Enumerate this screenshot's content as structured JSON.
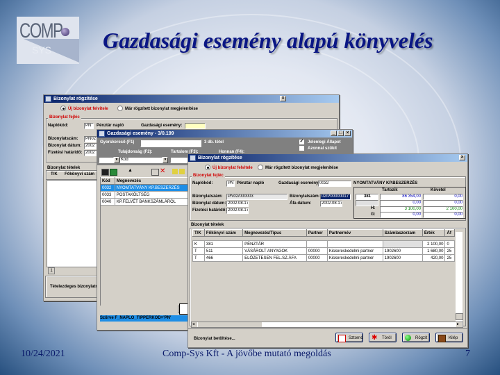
{
  "slide": {
    "title": "Gazdasági esemény alapú könyvelés",
    "logo_top": "COMP",
    "logo_bottom": "SYS",
    "footer_date": "10/24/2021",
    "footer_center": "Comp-Sys Kft - A jövőbe mutató megoldás",
    "page_number": "7"
  },
  "win1": {
    "title": "Bizonylat rögzítése",
    "radio_new": "Új bizonylat felvitele",
    "radio_edit": "Már rögzített bizonylat megjelenítése",
    "group_head": "Bizonylat fejléc",
    "naplokod_label": "Naplókód:",
    "naplokod_value": "PN",
    "naplokod_name": "Pénztár napló",
    "gazd_label": "Gazdasági esemény:",
    "bizszam_label": "Bizonylatszám:",
    "bizszam_value": "PN02",
    "bizdatum_label": "Bizonylat dátum:",
    "bizdatum_value": "2002",
    "fizhat_label": "Fizetési határidő:",
    "fizhat_value": "2002",
    "items_group": "Bizonylat tételek",
    "col_tk": "T/K",
    "col_fokonyv": "Főkönyvi szám",
    "page": "1",
    "status": "Tételezdeges bizonylatr"
  },
  "win2": {
    "title": "Gazdasági esemény - 3/0.199",
    "gyors_label": "Gyorskereső (F1)",
    "count": "3 db. tétel",
    "tulajdonsag_label": "Tulajdonság (F2):",
    "tulajdonsag_value": "Kód",
    "tartalom_label": "Tartalom (F3):",
    "honnan_label": "Honnan (F4):",
    "chk_jelenlegi": "Jelenlegi Állapot",
    "chk_azonnal": "Azonnal szűkít",
    "col_kod": "Kód",
    "col_megnevezes": "Megnevezés",
    "rows": [
      {
        "kod": "0032",
        "megnevezes": "NYOMTATVÁNY KP.BESZERZÉS"
      },
      {
        "kod": "0033",
        "megnevezes": "POSTAKÖLTSÉG"
      },
      {
        "kod": "0040",
        "megnevezes": "KP.FELVÉT BANKSZÁMLÁRÓL"
      }
    ],
    "filter": "Szűrve F_NAPLO_TIPPERKOD='PN'"
  },
  "win3": {
    "title": "Bizonylat rögzítése",
    "radio_new": "Új bizonylat felvitele",
    "radio_edit": "Már rögzített bizonylat megjelenítése",
    "group_head": "Bizonylat fejléc",
    "naplokod_label": "Naplókód:",
    "naplokod_value": "PN",
    "naplokod_name": "Pénztár napló",
    "gazd_label": "Gazdasági esemény:",
    "gazd_value": "0032",
    "bizszam_label": "Bizonylatszám:",
    "bizszam_value": "PN02/000003",
    "bizdatum_label": "Bizonylat dátum:",
    "bizdatum_value": "2002.08.17",
    "fizhat_label": "Fizetési határidő:",
    "fizhat_value": "2002.08.17",
    "bizszam2_label": "Bizonylatszám:",
    "bizszam2_value": "02/P00000017",
    "afa_label": "Áfa dátum:",
    "afa_value": "2002.08.17",
    "event_name": "NYOMTATVÁNY KP.BESZERZÉS",
    "summary": {
      "col_tartozik": "Tartozik",
      "col_kovetel": "Követel",
      "rows": [
        {
          "label": "381",
          "tartozik": "86 354,00",
          "kovetel": "0,00"
        },
        {
          "label": "",
          "tartozik": "0,00",
          "kovetel": "0,00"
        },
        {
          "label": "H:",
          "tartozik": "3 100,00",
          "kovetel": "2 100,00"
        },
        {
          "label": "G:",
          "tartozik": "0,00",
          "kovetel": "0,00"
        }
      ]
    },
    "items_group": "Bizonylat tételek",
    "columns": [
      "T/K",
      "Főkönyvi szám",
      "Megnevezés/Típus",
      "Partner",
      "Partnernév",
      "Számlaszorzam",
      "Érték",
      "Áf"
    ],
    "rows": [
      {
        "tk": "K",
        "fokonyv": "381",
        "megnevezes": "PÉNZTÁR",
        "partner": "",
        "partnernev": "",
        "szamla": "",
        "ertek": "2 100,00",
        "af": "0"
      },
      {
        "tk": "T",
        "fokonyv": "511",
        "megnevezes": "VÁSÁROLT ANYAGOK",
        "partner": "00000",
        "partnernev": "Kiskereskedelmi partner",
        "szamla": "1902600",
        "ertek": "1 680,00",
        "af": "25"
      },
      {
        "tk": "T",
        "fokonyv": "466",
        "megnevezes": "ELŐZETESEN FEL.SZ.ÁFA",
        "partner": "00000",
        "partnernev": "Kiskereskedelmi partner",
        "szamla": "1902600",
        "ertek": "420,00",
        "af": "25"
      }
    ],
    "status": "Bizonylat betöltése...",
    "buttons": {
      "sztorno": "Sztornó",
      "torol": "Töröl",
      "rogzit": "Rögzít",
      "kilep": "Kilép"
    }
  },
  "colors": {
    "title_blue": "#0a1684",
    "titlebar_start": "#0a246a",
    "titlebar_end": "#a6caf0",
    "selection": "#1e8ee6",
    "yellow_field": "#ffffc0",
    "label_red": "#d00000",
    "value_blue": "#0000c0",
    "value_green": "#008000"
  }
}
